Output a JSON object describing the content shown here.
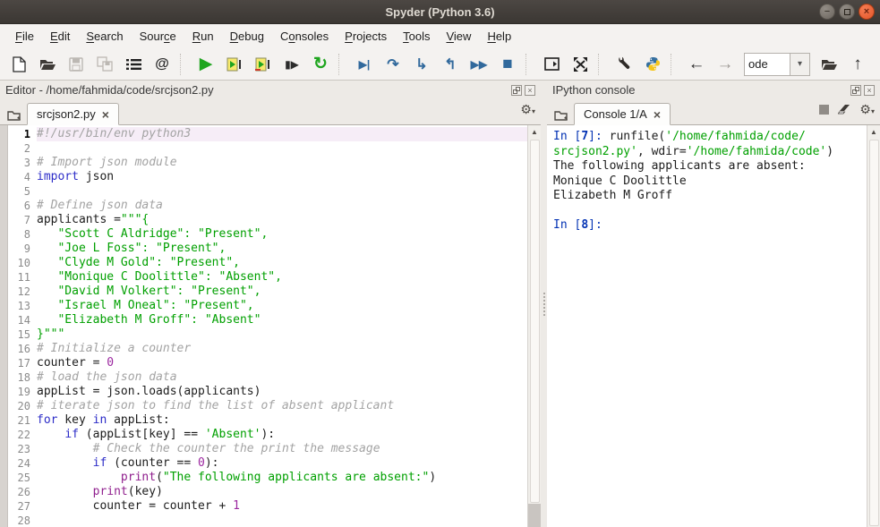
{
  "window": {
    "title": "Spyder (Python 3.6)"
  },
  "menu": {
    "items": [
      {
        "id": "file",
        "pre": "",
        "key": "F",
        "post": "ile"
      },
      {
        "id": "edit",
        "pre": "",
        "key": "E",
        "post": "dit"
      },
      {
        "id": "search",
        "pre": "",
        "key": "S",
        "post": "earch"
      },
      {
        "id": "source",
        "pre": "Sour",
        "key": "c",
        "post": "e"
      },
      {
        "id": "run",
        "pre": "",
        "key": "R",
        "post": "un"
      },
      {
        "id": "debug",
        "pre": "",
        "key": "D",
        "post": "ebug"
      },
      {
        "id": "consoles",
        "pre": "C",
        "key": "o",
        "post": "nsoles"
      },
      {
        "id": "projects",
        "pre": "",
        "key": "P",
        "post": "rojects"
      },
      {
        "id": "tools",
        "pre": "",
        "key": "T",
        "post": "ools"
      },
      {
        "id": "view",
        "pre": "",
        "key": "V",
        "post": "iew"
      },
      {
        "id": "help",
        "pre": "",
        "key": "H",
        "post": "elp"
      }
    ]
  },
  "toolbar": {
    "working_directory_value": "ode"
  },
  "icons": {
    "at": "@",
    "run": "▶",
    "run_selection": "▮▶",
    "rerun": "↻",
    "debug": "▶|",
    "step_over": "↷",
    "step_into": "↳",
    "step_return": "↰",
    "continue": "▶▶",
    "stop": "■",
    "back": "←",
    "forward": "→",
    "up": "↑",
    "gear": "⚙",
    "gear_arrow": "▾",
    "combo_arrow": "▾",
    "scroll_up": "▲",
    "tab_close": "×",
    "minimize": "−"
  },
  "editor": {
    "title": "Editor - /home/fahmida/code/srcjson2.py",
    "tab_label": "srcjson2.py",
    "code": [
      {
        "n": 1,
        "cur": true,
        "seg": [
          {
            "c": "com",
            "t": "#!/usr/bin/env python3"
          }
        ]
      },
      {
        "n": 2,
        "seg": []
      },
      {
        "n": 3,
        "seg": [
          {
            "c": "com",
            "t": "# Import json module"
          }
        ]
      },
      {
        "n": 4,
        "seg": [
          {
            "c": "kw",
            "t": "import"
          },
          {
            "c": "pl",
            "t": " json"
          }
        ]
      },
      {
        "n": 5,
        "seg": []
      },
      {
        "n": 6,
        "seg": [
          {
            "c": "com",
            "t": "# Define json data"
          }
        ]
      },
      {
        "n": 7,
        "seg": [
          {
            "c": "pl",
            "t": "applicants ="
          },
          {
            "c": "str",
            "t": "\"\"\"{"
          }
        ]
      },
      {
        "n": 8,
        "seg": [
          {
            "c": "str",
            "t": "   \"Scott C Aldridge\": \"Present\","
          }
        ]
      },
      {
        "n": 9,
        "seg": [
          {
            "c": "str",
            "t": "   \"Joe L Foss\": \"Present\","
          }
        ]
      },
      {
        "n": 10,
        "seg": [
          {
            "c": "str",
            "t": "   \"Clyde M Gold\": \"Present\","
          }
        ]
      },
      {
        "n": 11,
        "seg": [
          {
            "c": "str",
            "t": "   \"Monique C Doolittle\": \"Absent\","
          }
        ]
      },
      {
        "n": 12,
        "seg": [
          {
            "c": "str",
            "t": "   \"David M Volkert\": \"Present\","
          }
        ]
      },
      {
        "n": 13,
        "seg": [
          {
            "c": "str",
            "t": "   \"Israel M Oneal\": \"Present\","
          }
        ]
      },
      {
        "n": 14,
        "seg": [
          {
            "c": "str",
            "t": "   \"Elizabeth M Groff\": \"Absent\""
          }
        ]
      },
      {
        "n": 15,
        "seg": [
          {
            "c": "str",
            "t": "}\"\"\""
          }
        ]
      },
      {
        "n": 16,
        "seg": [
          {
            "c": "com",
            "t": "# Initialize a counter"
          }
        ]
      },
      {
        "n": 17,
        "seg": [
          {
            "c": "pl",
            "t": "counter = "
          },
          {
            "c": "num",
            "t": "0"
          }
        ]
      },
      {
        "n": 18,
        "seg": [
          {
            "c": "com",
            "t": "# load the json data"
          }
        ]
      },
      {
        "n": 19,
        "seg": [
          {
            "c": "pl",
            "t": "appList = json.loads(applicants)"
          }
        ]
      },
      {
        "n": 20,
        "seg": [
          {
            "c": "com",
            "t": "# iterate json to find the list of absent applicant"
          }
        ]
      },
      {
        "n": 21,
        "seg": [
          {
            "c": "kw",
            "t": "for"
          },
          {
            "c": "pl",
            "t": " key "
          },
          {
            "c": "kw",
            "t": "in"
          },
          {
            "c": "pl",
            "t": " appList:"
          }
        ]
      },
      {
        "n": 22,
        "seg": [
          {
            "c": "pl",
            "t": "    "
          },
          {
            "c": "kw",
            "t": "if"
          },
          {
            "c": "pl",
            "t": " (appList[key] == "
          },
          {
            "c": "str",
            "t": "'Absent'"
          },
          {
            "c": "pl",
            "t": "):"
          }
        ]
      },
      {
        "n": 23,
        "seg": [
          {
            "c": "pl",
            "t": "        "
          },
          {
            "c": "com",
            "t": "# Check the counter the print the message"
          }
        ]
      },
      {
        "n": 24,
        "seg": [
          {
            "c": "pl",
            "t": "        "
          },
          {
            "c": "kw",
            "t": "if"
          },
          {
            "c": "pl",
            "t": " (counter == "
          },
          {
            "c": "num",
            "t": "0"
          },
          {
            "c": "pl",
            "t": "):"
          }
        ]
      },
      {
        "n": 25,
        "seg": [
          {
            "c": "pl",
            "t": "            "
          },
          {
            "c": "bi",
            "t": "print"
          },
          {
            "c": "pl",
            "t": "("
          },
          {
            "c": "str",
            "t": "\"The following applicants are absent:\""
          },
          {
            "c": "pl",
            "t": ")"
          }
        ]
      },
      {
        "n": 26,
        "seg": [
          {
            "c": "pl",
            "t": "        "
          },
          {
            "c": "bi",
            "t": "print"
          },
          {
            "c": "pl",
            "t": "(key)"
          }
        ]
      },
      {
        "n": 27,
        "seg": [
          {
            "c": "pl",
            "t": "        counter = counter + "
          },
          {
            "c": "num",
            "t": "1"
          }
        ]
      },
      {
        "n": 28,
        "seg": []
      }
    ]
  },
  "console": {
    "title": "IPython console",
    "tab_label": "Console 1/A",
    "lines": [
      {
        "seg": [
          {
            "c": "prompt",
            "t": "In ["
          },
          {
            "c": "pnum",
            "t": "7"
          },
          {
            "c": "prompt",
            "t": "]: "
          },
          {
            "c": "pl",
            "t": "runfile("
          },
          {
            "c": "str",
            "t": "'/home/fahmida/code/"
          }
        ]
      },
      {
        "seg": [
          {
            "c": "str",
            "t": "srcjson2.py'"
          },
          {
            "c": "pl",
            "t": ", wdir="
          },
          {
            "c": "str",
            "t": "'/home/fahmida/code'"
          },
          {
            "c": "pl",
            "t": ")"
          }
        ]
      },
      {
        "seg": [
          {
            "c": "out",
            "t": "The following applicants are absent:"
          }
        ]
      },
      {
        "seg": [
          {
            "c": "out",
            "t": "Monique C Doolittle"
          }
        ]
      },
      {
        "seg": [
          {
            "c": "out",
            "t": "Elizabeth M Groff"
          }
        ]
      },
      {
        "seg": []
      },
      {
        "seg": [
          {
            "c": "prompt",
            "t": "In ["
          },
          {
            "c": "pnum",
            "t": "8"
          },
          {
            "c": "prompt",
            "t": "]: "
          }
        ]
      }
    ]
  },
  "colors": {
    "titlebar": "#433f3b",
    "close_button": "#e4562a",
    "keyword": "#2d2dc8",
    "string": "#00a000",
    "builtin": "#90208e",
    "number": "#9c28a0",
    "comment": "#a3a3a3",
    "prompt": "#0433b4",
    "run_green": "#1fa51f",
    "debug_blue": "#31699c"
  }
}
